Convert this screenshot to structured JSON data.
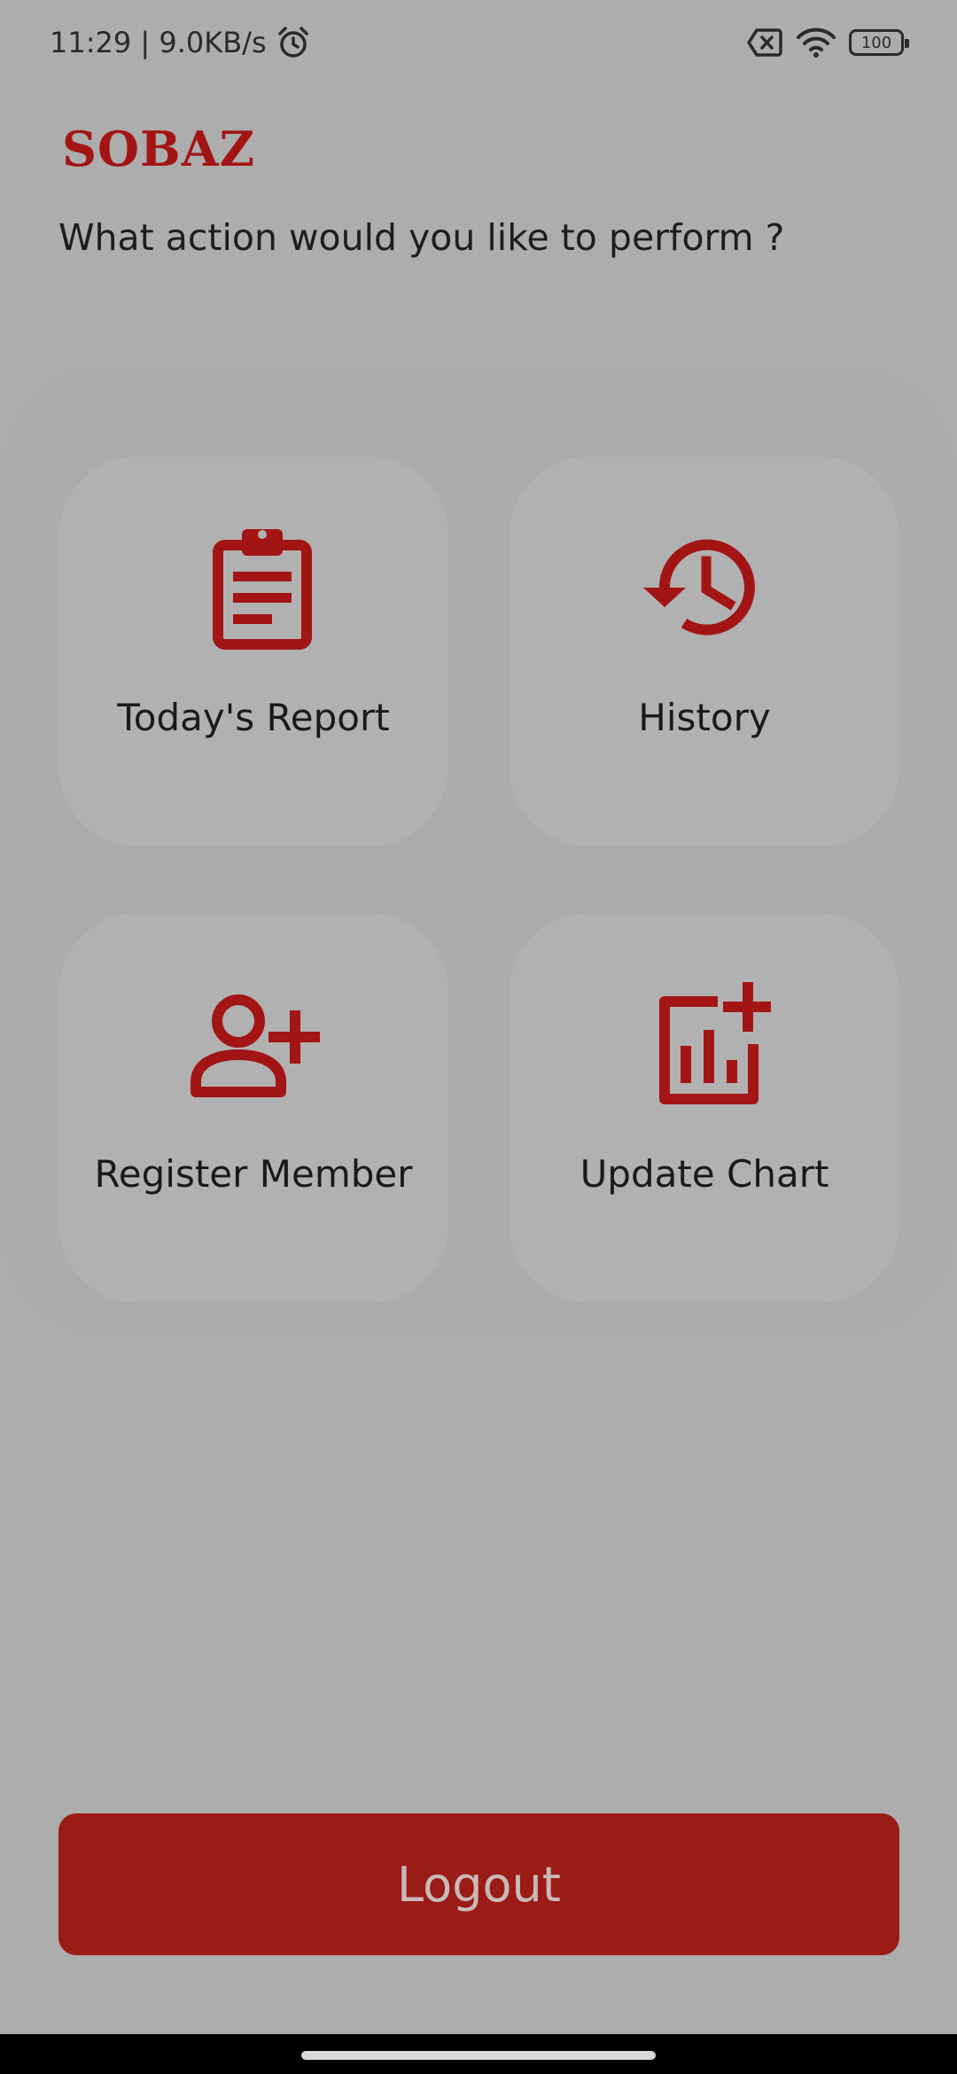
{
  "status_bar": {
    "time_speed": "11:29 | 9.0KB/s",
    "battery": "100",
    "alarm_icon": "alarm-icon",
    "sim_icon": "no-sim-icon",
    "wifi_icon": "wifi-icon"
  },
  "header": {
    "logo": "SOBAZ",
    "prompt": "What action would you like to perform ?"
  },
  "actions": [
    {
      "label": "Today's Report",
      "icon": "clipboard-icon"
    },
    {
      "label": "History",
      "icon": "history-icon"
    },
    {
      "label": "Register Member",
      "icon": "add-person-icon"
    },
    {
      "label": "Update Chart",
      "icon": "add-chart-icon"
    }
  ],
  "logout": {
    "label": "Logout"
  },
  "colors": {
    "accent": "#a31515",
    "background": "#adadad",
    "button": "#9b1b17"
  }
}
